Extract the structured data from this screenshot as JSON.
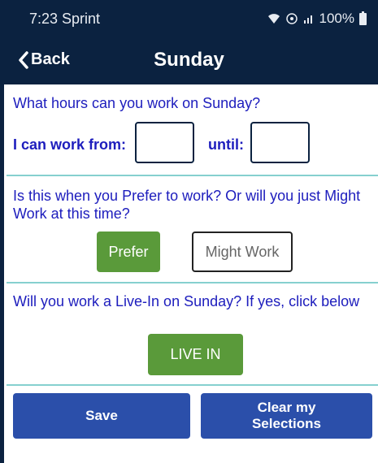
{
  "status_bar": {
    "time": "7:23 Sprint",
    "right_icons": "wifi-icon vowifi-icon signal-icon",
    "battery": "100%"
  },
  "nav": {
    "back_label": "Back",
    "title": "Sunday"
  },
  "hours": {
    "question": "What hours can you work on Sunday?",
    "from_label": "I can work from:",
    "until_label": "until:",
    "from_value": "",
    "until_value": ""
  },
  "preference": {
    "question": "Is this when you Prefer to work? Or will you just Might Work at this time?",
    "prefer_label": "Prefer",
    "might_label": "Might Work",
    "selected": "Prefer"
  },
  "live_in": {
    "question": "Will you work a Live-In on Sunday? If yes, click below",
    "button_label": "LIVE IN"
  },
  "actions": {
    "save_label": "Save",
    "clear_label": "Clear my Selections"
  },
  "colors": {
    "header": "#0b2240",
    "text_blue": "#1d1dbd",
    "green": "#5a9a3a",
    "button_blue": "#2b4faa",
    "divider": "#86d0cf"
  }
}
